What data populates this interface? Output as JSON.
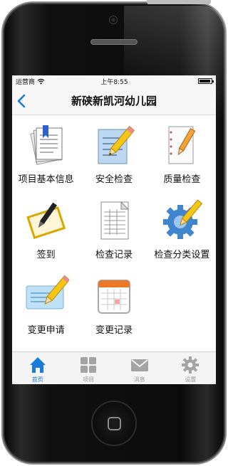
{
  "status": {
    "carrier": "运营商",
    "time": "上午8:55",
    "battery_level": 0.95
  },
  "nav": {
    "title": "新硖新凯河幼儿园",
    "back_icon": "chevron-left-icon"
  },
  "menu": [
    {
      "label": "项目基本信息",
      "icon": "documents-ribbon-icon"
    },
    {
      "label": "安全检查",
      "icon": "document-pencil-icon"
    },
    {
      "label": "质量检查",
      "icon": "notepad-pencil-icon"
    },
    {
      "label": "签到",
      "icon": "notebook-pen-icon"
    },
    {
      "label": "检查记录",
      "icon": "spreadsheet-icon"
    },
    {
      "label": "检查分类设置",
      "icon": "gear-pencil-icon"
    },
    {
      "label": "变更申请",
      "icon": "card-pencil-icon"
    },
    {
      "label": "变更记录",
      "icon": "calendar-icon"
    }
  ],
  "tabs": [
    {
      "label": "首页",
      "icon": "home-icon",
      "active": true
    },
    {
      "label": "项目",
      "icon": "grid-icon",
      "active": false
    },
    {
      "label": "消息",
      "icon": "mail-icon",
      "active": false
    },
    {
      "label": "设置",
      "icon": "gear-icon",
      "active": false
    }
  ],
  "colors": {
    "accent": "#1b7bd8",
    "tab_inactive": "#9a9a9a"
  }
}
